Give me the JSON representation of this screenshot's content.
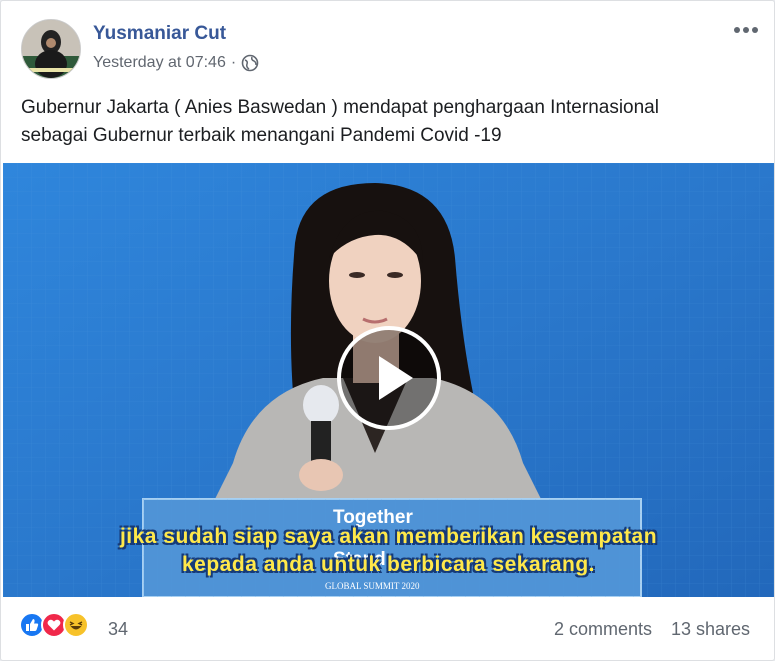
{
  "post": {
    "author": "Yusmaniar Cut",
    "timestamp": "Yesterday at 07:46",
    "separator": "·",
    "audience_icon": "globe-icon",
    "text_line1": "Gubernur Jakarta ( Anies Baswedan ) mendapat penghargaan Internasional",
    "text_line2": "sebagai Gubernur terbaik menangani Pandemi Covid -19"
  },
  "video": {
    "subtitle_line1": "jika sudah siap saya akan memberikan kesempatan",
    "subtitle_line2": "kepada anda untuk berbicara sekarang.",
    "podium_text1": "Together",
    "podium_text2": "Stand",
    "podium_text3": "GLOBAL SUMMIT 2020",
    "background_color": "#2d7bd0"
  },
  "stats": {
    "reaction_icons": [
      "like-icon",
      "love-icon",
      "haha-icon"
    ],
    "reaction_count": "34",
    "comments": "2 comments",
    "shares": "13 shares"
  }
}
